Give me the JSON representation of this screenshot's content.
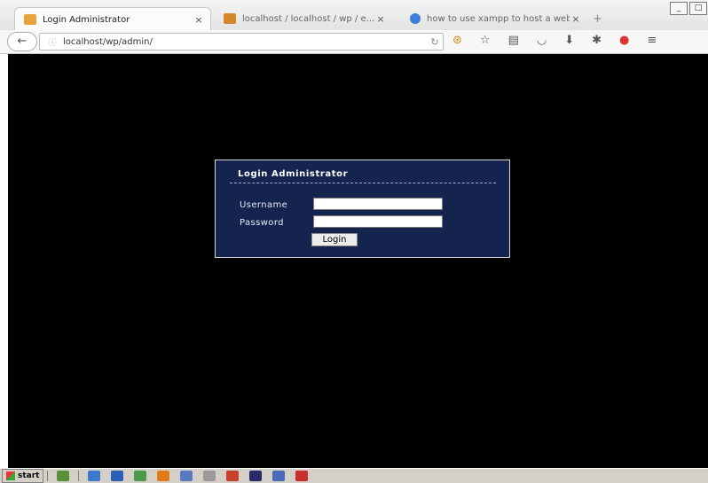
{
  "browser": {
    "tabs": [
      {
        "title": "Login Administrator",
        "close": "×",
        "favicon_color": "#e8a33d",
        "active": true
      },
      {
        "title": "localhost / localhost / wp / e...",
        "close": "×",
        "favicon_color": "#d4882b",
        "active": false
      },
      {
        "title": "how to use xampp to host a website",
        "close": "×",
        "favicon_color": "#3b7fd9",
        "active": false
      }
    ],
    "new_tab": "+",
    "window_controls": [
      "_",
      "□",
      "×"
    ],
    "navbar": {
      "back": "←",
      "site_icon": "ⓘ",
      "url": "localhost/wp/admin/",
      "reload": "↻",
      "icons": [
        "search-icon",
        "star-icon",
        "library-icon",
        "pocket-icon",
        "download-icon",
        "addon-icon",
        "badge-icon",
        "menu-icon"
      ],
      "icon_glyphs": [
        "⊛",
        "☆",
        "▤",
        "◡",
        "⬇",
        "✱",
        "●",
        "≡"
      ]
    }
  },
  "login": {
    "title": "Login Administrator",
    "username_label": "Username",
    "password_label": "Password",
    "username_value": "",
    "password_value": "",
    "button": "Login"
  },
  "taskbar": {
    "start": "start",
    "icon_colors": [
      "#5a8f3a",
      "#3a7acb",
      "#2a5fb8",
      "#4a9a4a",
      "#e07a1a",
      "#5a7ac0",
      "#9a9a9a",
      "#c8402a",
      "#2b2b6b",
      "#4a6ab8",
      "#c83030"
    ]
  },
  "colors": {
    "page_background": "#000000",
    "panel_background": "#14244f",
    "panel_border": "#d6d6d6"
  }
}
